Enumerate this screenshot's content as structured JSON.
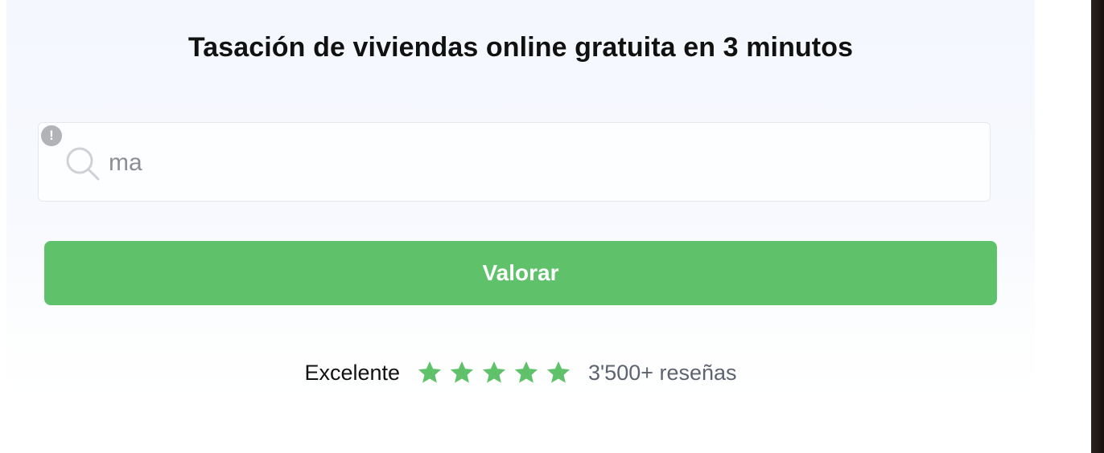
{
  "header": {
    "title": "Tasación de viviendas online gratuita en 3 minutos"
  },
  "search": {
    "value": "ma",
    "warning_glyph": "!",
    "icon": "search-icon"
  },
  "cta": {
    "label": "Valorar",
    "color": "#5fc26b"
  },
  "rating": {
    "label": "Excelente",
    "stars": 5,
    "star_color": "#5fc26b",
    "reviews": "3'500+ reseñas"
  }
}
